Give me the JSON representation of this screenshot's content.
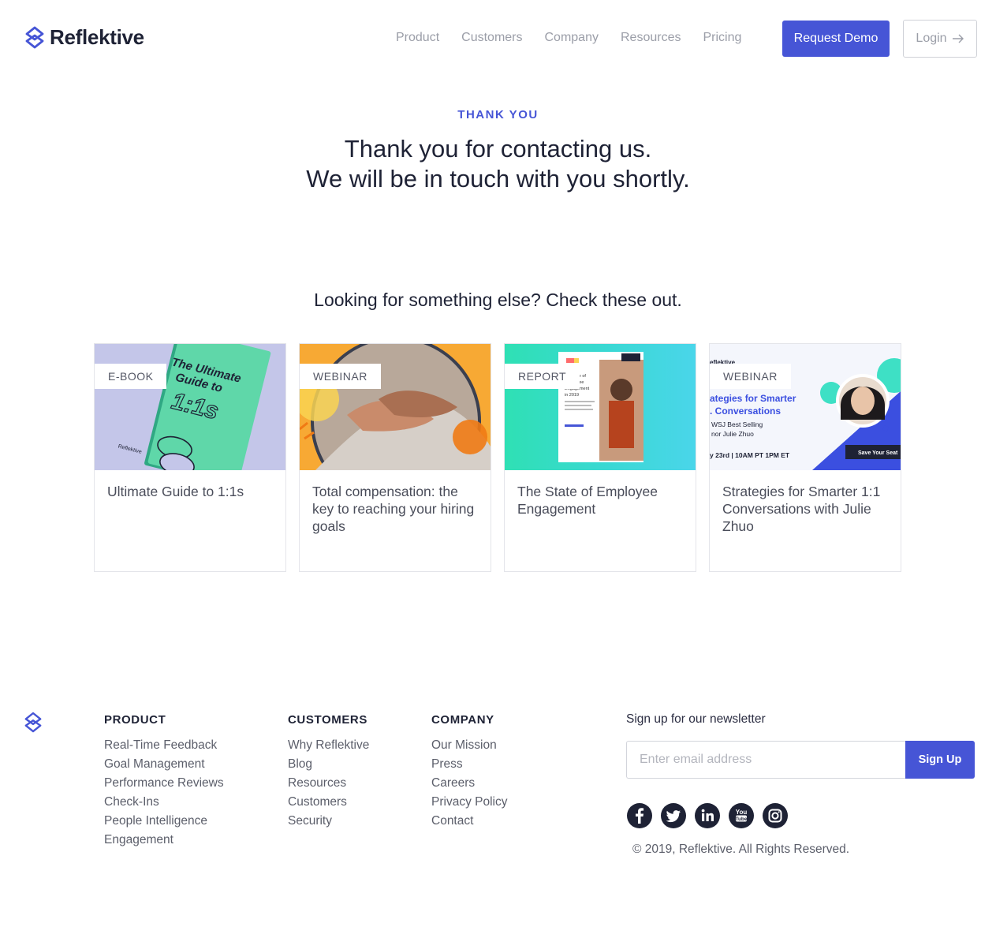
{
  "brand": {
    "name": "Reflektive",
    "accent_color": "#4655d6"
  },
  "nav": {
    "items": [
      {
        "label": "Product"
      },
      {
        "label": "Customers"
      },
      {
        "label": "Company"
      },
      {
        "label": "Resources"
      },
      {
        "label": "Pricing"
      }
    ],
    "demo_label": "Request Demo",
    "login_label": "Login",
    "login_icon": "arrow-right-icon"
  },
  "hero": {
    "eyebrow": "THANK YOU",
    "line1": "Thank you for contacting us.",
    "line2": "We will be in touch with you shortly."
  },
  "more": {
    "title": "Looking for something else? Check these out.",
    "cards": [
      {
        "tag": "E-BOOK",
        "title": "Ultimate Guide to 1:1s",
        "art": {
          "line1": "The Ultimate",
          "line2": "Guide to",
          "line3": "1:1s",
          "brand": "Reflektive"
        }
      },
      {
        "tag": "WEBINAR",
        "title": "Total compensation: the key to reaching your hiring goals"
      },
      {
        "tag": "REPORT",
        "title": "The State of Employee Engagement",
        "art": {
          "doc_line1": "State of",
          "doc_line2": "Employee",
          "doc_line3": "Engagement",
          "doc_line4": "in 2019"
        }
      },
      {
        "tag": "WEBINAR",
        "title": "Strategies for Smarter 1:1 Conversations with Julie Zhuo",
        "art": {
          "brand": "eflektive",
          "headline1": "ategies for Smarter",
          "headline2": ". Conversations",
          "sub1": "WSJ Best Selling",
          "sub2": "nor Julie Zhuo",
          "date": "y 23rd  |  10AM PT 1PM ET",
          "cta": "Save Your Seat"
        }
      }
    ]
  },
  "footer": {
    "product": {
      "heading": "PRODUCT",
      "links": [
        "Real-Time Feedback",
        "Goal Management",
        "Performance Reviews",
        "Check-Ins",
        "People Intelligence",
        "Engagement"
      ]
    },
    "customers": {
      "heading": "CUSTOMERS",
      "links": [
        "Why Reflektive",
        "Blog",
        "Resources",
        "Customers",
        "Security"
      ]
    },
    "company": {
      "heading": "COMPANY",
      "links": [
        "Our Mission",
        "Press",
        "Careers",
        "Privacy Policy",
        "Contact"
      ]
    },
    "newsletter": {
      "label": "Sign up for our newsletter",
      "email_placeholder": "Enter email address",
      "email_value": "",
      "signup_label": "Sign Up"
    },
    "socials": [
      "facebook-icon",
      "twitter-icon",
      "linkedin-icon",
      "youtube-icon",
      "instagram-icon"
    ],
    "copyright": "© 2019, Reflektive. All Rights Reserved."
  }
}
